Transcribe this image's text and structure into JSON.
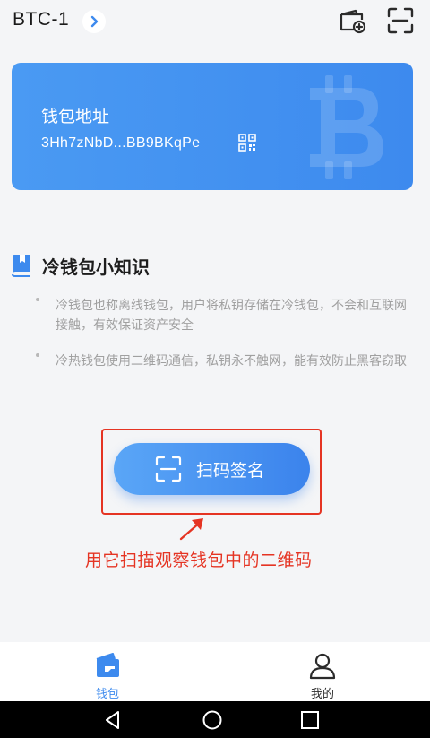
{
  "header": {
    "wallet_name": "BTC-1",
    "chevron_icon": "chevron-right-icon",
    "add_wallet_icon": "wallet-add-icon",
    "scan_icon": "scan-icon"
  },
  "wallet_card": {
    "label": "钱包地址",
    "address": "3Hh7zNbD...BB9BKqPe",
    "qr_icon": "qr-code-icon",
    "watermark_icon": "bitcoin-icon"
  },
  "tips": {
    "title": "冷钱包小知识",
    "items": [
      {
        "text": "冷钱包也称离线钱包，用户将私钥存储在冷钱包，不会和互联网接触，有效保证资产安全"
      },
      {
        "text": "冷热钱包使用二维码通信，私钥永不触网，能有效防止黑客窃取"
      }
    ]
  },
  "scan_button": {
    "label": "扫码签名",
    "icon": "scan-icon"
  },
  "annotation": {
    "text": "用它扫描观察钱包中的二维码",
    "color": "#e53423"
  },
  "tabbar": {
    "tabs": [
      {
        "label": "钱包",
        "icon": "wallet-icon",
        "active": true
      },
      {
        "label": "我的",
        "icon": "person-icon",
        "active": false
      }
    ]
  },
  "colors": {
    "accent": "#3d8aee",
    "background": "#f4f5f7",
    "annotation_red": "#e53423"
  }
}
